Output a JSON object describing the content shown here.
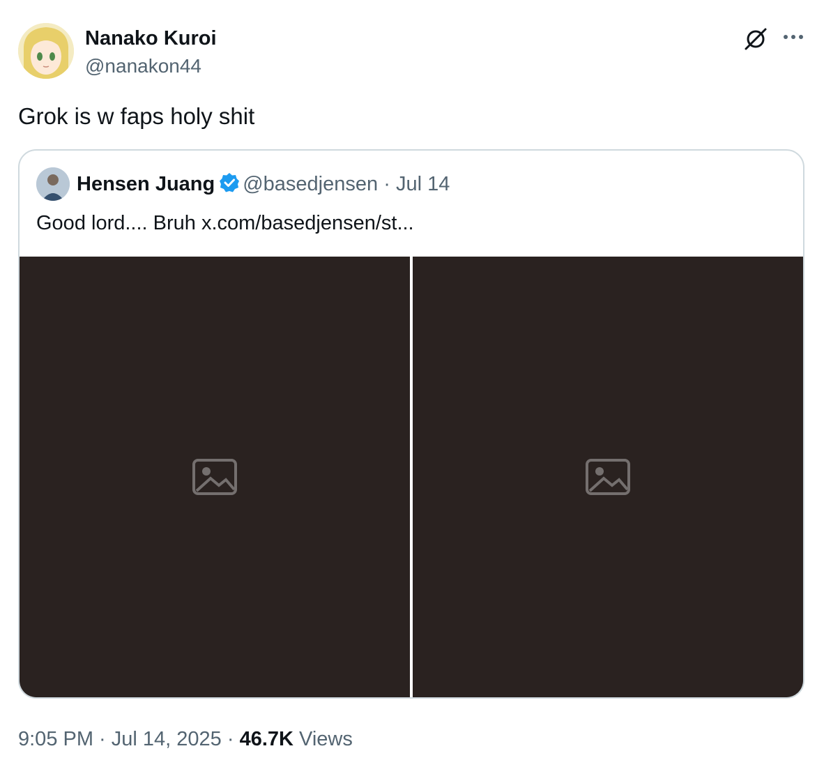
{
  "author": {
    "name": "Nanako Kuroi",
    "handle": "@nanakon44",
    "avatar_icon": "anime-avatar-icon"
  },
  "header_actions": {
    "grok_icon": "grok-icon",
    "more_icon": "more-icon"
  },
  "tweet": {
    "text": "Grok is w faps holy shit"
  },
  "quote": {
    "avatar_icon": "profile-photo-icon",
    "name": "Hensen Juang",
    "verified_icon": "verified-badge-icon",
    "handle": "@basedjensen",
    "separator": "·",
    "date": "Jul 14",
    "text": "Good lord.... Bruh  x.com/basedjensen/st...",
    "media_count": 2
  },
  "footer": {
    "time": "9:05 PM",
    "sep1": " · ",
    "date": "Jul 14, 2025",
    "sep2": " · ",
    "views_count": "46.7K",
    "views_label": " Views"
  },
  "colors": {
    "text_primary": "#0f1419",
    "text_secondary": "#536471",
    "border": "#cfd9de",
    "verified_blue": "#1d9bf0"
  }
}
